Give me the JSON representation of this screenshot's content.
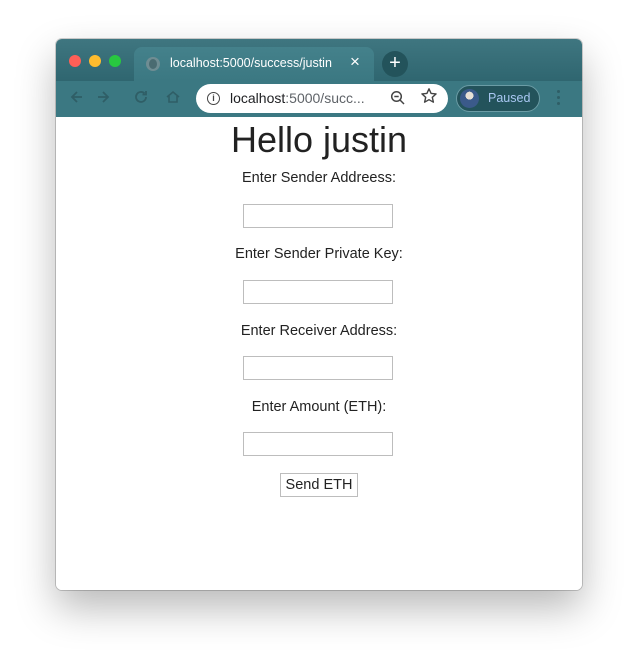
{
  "browser": {
    "tab": {
      "title": "localhost:5000/success/justin",
      "close_glyph": "×"
    },
    "new_tab_glyph": "+",
    "address_bar": {
      "host": "localhost",
      "rest": ":5000/succ..."
    },
    "profile": {
      "label": "Paused"
    }
  },
  "page": {
    "heading": "Hello justin",
    "form": {
      "fields": [
        {
          "label": "Enter Sender Addreess:",
          "value": ""
        },
        {
          "label": "Enter Sender Private Key:",
          "value": ""
        },
        {
          "label": "Enter Receiver Address:",
          "value": ""
        },
        {
          "label": "Enter Amount (ETH):",
          "value": ""
        }
      ],
      "submit_label": "Send ETH"
    }
  },
  "icons": [
    "globe-icon",
    "close-icon",
    "plus-icon",
    "back-icon",
    "forward-icon",
    "reload-icon",
    "home-icon",
    "info-icon",
    "zoom-icon",
    "star-icon",
    "avatar",
    "more-icon"
  ],
  "colors": {
    "titlebar": "#2f6670",
    "toolbar": "#3b7882",
    "text": "#222222",
    "profile_text": "#a9c7f2"
  }
}
